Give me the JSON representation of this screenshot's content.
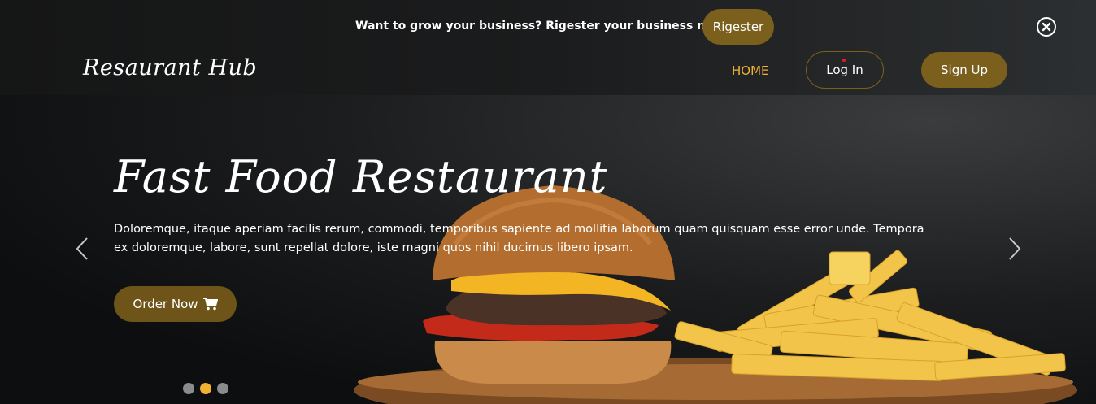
{
  "announcement": {
    "text": "Want to grow your business? Rigester your business now!",
    "button_label": "Rigester"
  },
  "navbar": {
    "brand": "Resaurant Hub",
    "home_label": "HOME",
    "login_label": "Log In",
    "signup_label": "Sign Up"
  },
  "hero": {
    "title": "Fast Food Restaurant",
    "description": "Doloremque, itaque aperiam facilis rerum, commodi, temporibus sapiente ad mollitia laborum quam quisquam esse error unde. Tempora ex doloremque, labore, sunt repellat dolore, iste magni quos nihil ducimus libero ipsam.",
    "order_label": "Order Now"
  },
  "carousel": {
    "slide_count": 3,
    "active_index": 1
  },
  "colors": {
    "accent": "#f1b132",
    "button_brown": "#7a5f1d",
    "order_brown": "#6e5418",
    "dot_inactive": "#8a8b8c"
  },
  "icons": [
    "close-icon",
    "cart-icon",
    "chevron-left-icon",
    "chevron-right-icon"
  ]
}
